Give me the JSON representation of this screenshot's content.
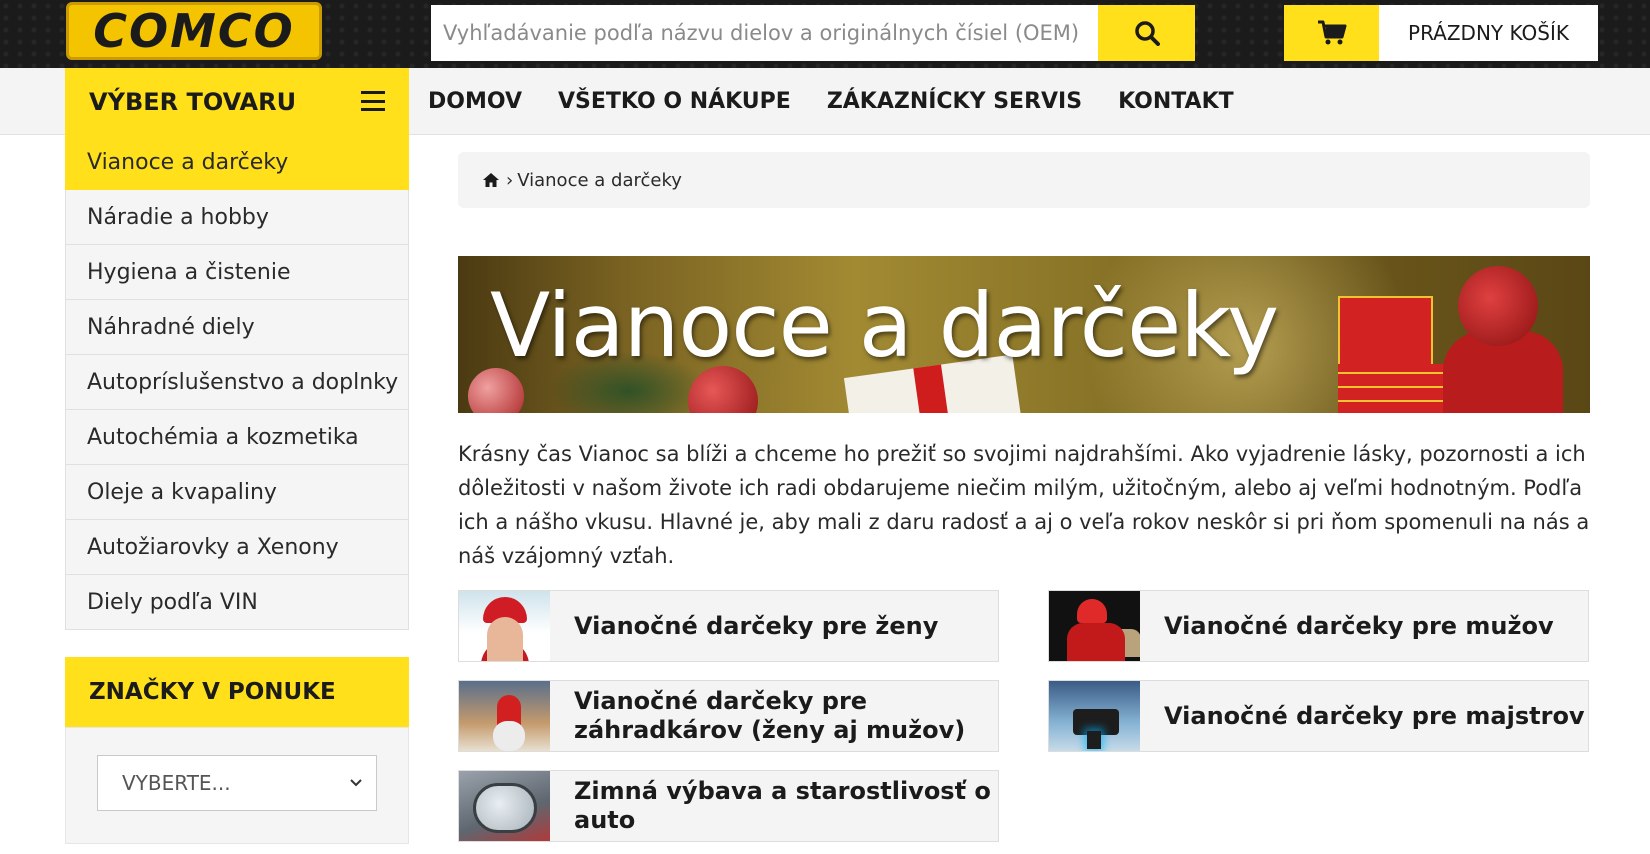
{
  "logo": {
    "text": "COMCO"
  },
  "search": {
    "placeholder": "Vyhľadávanie podľa názvu dielov a originálnych čísiel (OEM)"
  },
  "cart": {
    "label": "PRÁZDNY KOŠÍK"
  },
  "category_menu": {
    "title": "VÝBER TOVARU"
  },
  "nav": {
    "items": [
      {
        "label": "DOMOV"
      },
      {
        "label": "VŠETKO O NÁKUPE"
      },
      {
        "label": "ZÁKAZNÍCKY SERVIS"
      },
      {
        "label": "KONTAKT"
      }
    ]
  },
  "sidebar": {
    "items": [
      {
        "label": "Vianoce a darčeky",
        "active": true
      },
      {
        "label": "Náradie a hobby"
      },
      {
        "label": "Hygiena a čistenie"
      },
      {
        "label": "Náhradné diely"
      },
      {
        "label": "Autopríslušenstvo a doplnky"
      },
      {
        "label": "Autochémia a kozmetika"
      },
      {
        "label": "Oleje a kvapaliny"
      },
      {
        "label": "Autožiarovky a Xenony"
      },
      {
        "label": "Diely podľa VIN"
      }
    ]
  },
  "brands": {
    "title": "ZNAČKY V PONUKE",
    "select_value": "VYBERTE..."
  },
  "breadcrumb": {
    "separator": "›",
    "current": "Vianoce a darčeky"
  },
  "banner": {
    "text": "Vianoce a darčeky"
  },
  "intro": "Krásny čas Vianoc sa blíži a chceme ho prežiť so svojimi najdrahšími. Ako vyjadrenie lásky, pozornosti a ich dôležitosti v našom živote ich radi obdarujeme niečim milým, užitočným, alebo aj veľmi hodnotným. Podľa ich a nášho vkusu. Hlavné je, aby mali z daru radosť a aj o veľa rokov neskôr si pri ňom spomenuli na nás a náš vzájomný vzťah.",
  "categories": [
    {
      "label": "Vianočné darčeky pre ženy"
    },
    {
      "label": "Vianočné darčeky pre mužov"
    },
    {
      "label": "Vianočné darčeky pre záhradkárov (ženy aj mužov)"
    },
    {
      "label": "Vianočné darčeky pre majstrov"
    },
    {
      "label": "Zimná výbava a starostlivosť o auto"
    }
  ],
  "colors": {
    "accent": "#ffe01b",
    "topbar": "#1b1b1b",
    "panel": "#f4f4f4"
  }
}
